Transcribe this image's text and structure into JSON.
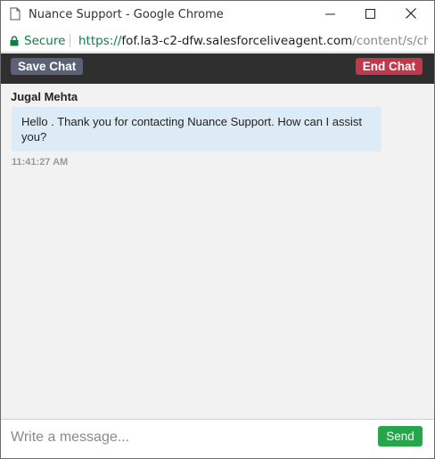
{
  "window": {
    "title": "Nuance Support - Google Chrome"
  },
  "addressbar": {
    "secure_label": "Secure",
    "url_scheme": "https://",
    "url_host": "fof.la3-c2-dfw.salesforceliveagent.com",
    "url_path": "/content/s/chat..."
  },
  "toolbar": {
    "save_label": "Save Chat",
    "end_label": "End Chat"
  },
  "chat": {
    "messages": [
      {
        "sender": "Jugal Mehta",
        "text": "Hello . Thank you for contacting Nuance Support.  How can I assist you?",
        "time": "11:41:27 AM"
      }
    ]
  },
  "composer": {
    "placeholder": "Write a message...",
    "value": "",
    "send_label": "Send"
  },
  "colors": {
    "secure_green": "#0b8043",
    "save_button": "#5b6277",
    "end_button": "#c0394b",
    "send_button": "#27a54a",
    "bubble_bg": "#ddebf7",
    "toolbar_bg": "#2f2f2f"
  },
  "icons": {
    "page": "page-icon",
    "lock": "lock-icon",
    "minimize": "minimize-icon",
    "maximize": "maximize-icon",
    "close": "close-icon"
  }
}
